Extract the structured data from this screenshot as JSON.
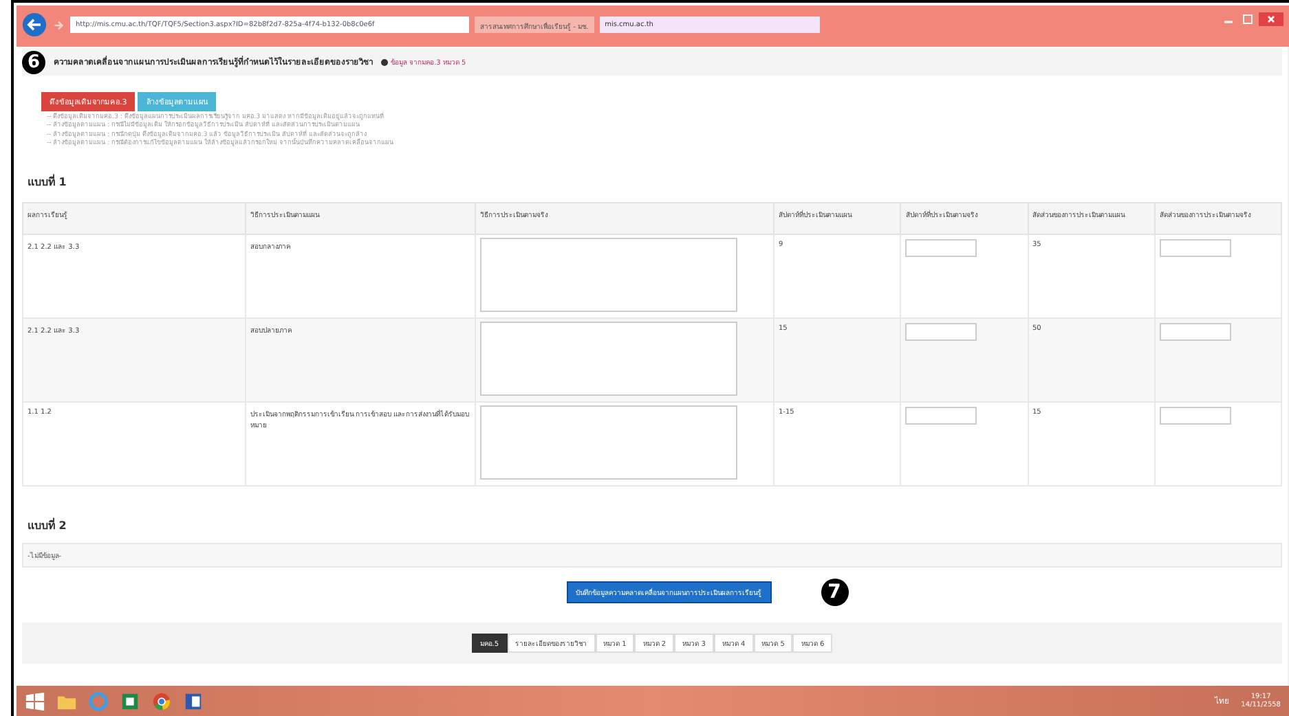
{
  "browser": {
    "url": "http://mis.cmu.ac.th/TQF/TQF5/Section3.aspx?ID=82b8f2d7-825a-4f74-b132-0b8c0e6f",
    "tabs": [
      {
        "title": "สารสนเทศการศึกษาเพื่อเรียนรู้ - มช.",
        "selected": false
      },
      {
        "title": "mis.cmu.ac.th",
        "selected": true
      }
    ]
  },
  "annotations": [
    "6",
    "7"
  ],
  "page": {
    "heading": "ความคลาดเคลื่อนจากแผนการประเมินผลการเรียนรู้ที่กำหนดไว้ในรายละเอียดของรายวิชา",
    "heading_note": "ข้อมูล จากมคอ.3 หมวด 5",
    "buttons": [
      {
        "label": "ดึงข้อมูลเดิมจากมคอ.3",
        "kind": "danger"
      },
      {
        "label": "ล้างข้อมูลตามแผน",
        "kind": "info"
      }
    ],
    "notes": [
      "-- ดึงข้อมูลเดิมจากมคอ.3 : ดึงข้อมูลแผนการประเมินผลการเรียนรู้จาก มคอ.3 มาแสดง หากมีข้อมูลเดิมอยู่แล้วจะถูกแทนที่",
      "-- ล้างข้อมูลตามแผน : กรณีไม่มีข้อมูลเดิม ให้กรอกข้อมูลวิธีการประเมิน สัปดาห์ที่ และสัดส่วนการประเมินตามแผน",
      "-- ล้างข้อมูลตามแผน : กรณีกดปุ่ม ดึงข้อมูลเดิมจากมคอ.3 แล้ว ข้อมูลวิธีการประเมิน สัปดาห์ที่ และสัดส่วนจะถูกล้าง",
      "-- ล้างข้อมูลตามแผน : กรณีต้องการแก้ไขข้อมูลตามแผน ให้ล้างข้อมูลแล้วกรอกใหม่ จากนั้นบันทึกความคลาดเคลื่อนจากแผน"
    ],
    "form1": {
      "title": "แบบที่ 1",
      "columns": [
        "ผลการเรียนรู้",
        "วิธีการประเมินตามแผน",
        "วิธีการประเมินตามจริง",
        "สัปดาห์ที่ประเมินตามแผน",
        "สัปดาห์ที่ประเมินตามจริง",
        "สัดส่วนของการประเมินตามแผน",
        "สัดส่วนของการประเมินตามจริง"
      ],
      "rows": [
        {
          "outcome": "2.1 2.2 และ 3.3",
          "method": "สอบกลางภาค",
          "week": "9",
          "weight": "35"
        },
        {
          "outcome": "2.1 2.2 และ 3.3",
          "method": "สอบปลายภาค",
          "week": "15",
          "weight": "50"
        },
        {
          "outcome": "1.1 1.2",
          "method": "ประเมินจากพฤติกรรมการเข้าเรียน การเข้าสอบ และการส่งงานที่ได้รับมอบหมาย",
          "week": "1-15",
          "weight": "15"
        }
      ]
    },
    "form2": {
      "title": "แบบที่ 2",
      "empty_text": "-ไม่มีข้อมูล-"
    },
    "save_button": "บันทึกข้อมูลความคลาดเคลื่อนจากแผนการประเมินผลการเรียนรู้",
    "pager": [
      {
        "label": "มคอ.5",
        "selected": true
      },
      {
        "label": "รายละเอียดของรายวิชา",
        "selected": false
      },
      {
        "label": "หมวด 1",
        "selected": false
      },
      {
        "label": "หมวด 2",
        "selected": false
      },
      {
        "label": "หมวด 3",
        "selected": false
      },
      {
        "label": "หมวด 4",
        "selected": false
      },
      {
        "label": "หมวด 5",
        "selected": false
      },
      {
        "label": "หมวด 6",
        "selected": false
      }
    ]
  },
  "taskbar": {
    "language": "ไทย",
    "time": "19:17",
    "date": "14/11/2558"
  }
}
